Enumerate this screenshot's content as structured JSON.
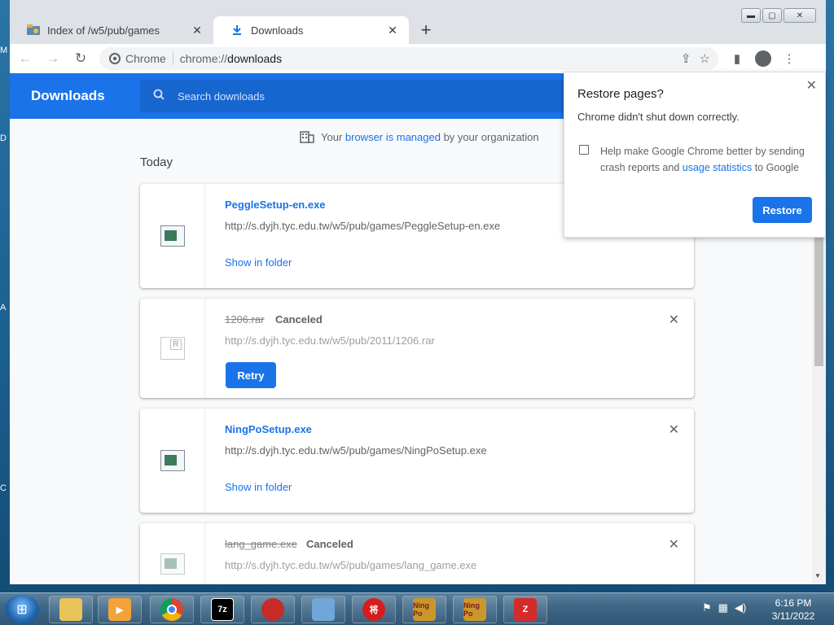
{
  "desktop": {
    "fragments": [
      "M",
      "D",
      "A",
      "C"
    ]
  },
  "window": {
    "tabs": [
      {
        "title": "Index of /w5/pub/games",
        "close": "✕"
      },
      {
        "title": "Downloads",
        "close": "✕"
      }
    ],
    "new_tab": "+",
    "controls": {
      "minimize": "▬",
      "maximize": "▢",
      "close": "✕"
    }
  },
  "toolbar": {
    "back": "←",
    "forward": "→",
    "reload": "↻",
    "chip_label": "Chrome",
    "url_scheme": "chrome://",
    "url_host": "downloads",
    "share": "⇪",
    "bookmark": "☆",
    "sidepanel": "▮",
    "menu": "⋮"
  },
  "downloads": {
    "title": "Downloads",
    "search_placeholder": "Search downloads",
    "managed_pre": "Your ",
    "managed_link": "browser is managed",
    "managed_post": " by your organization",
    "section": "Today",
    "items": [
      {
        "name": "PeggleSetup-en.exe",
        "url": "http://s.dyjh.tyc.edu.tw/w5/pub/games/PeggleSetup-en.exe",
        "action": "Show in folder",
        "status": ""
      },
      {
        "name": "1206.rar",
        "url": "http://s.dyjh.tyc.edu.tw/w5/pub/2011/1206.rar",
        "action": "Retry",
        "status": "Canceled"
      },
      {
        "name": "NingPoSetup.exe",
        "url": "http://s.dyjh.tyc.edu.tw/w5/pub/games/NingPoSetup.exe",
        "action": "Show in folder",
        "status": ""
      },
      {
        "name": "lang_game.exe",
        "url": "http://s.dyjh.tyc.edu.tw/w5/pub/games/lang_game.exe",
        "action": "",
        "status": "Canceled"
      }
    ],
    "remove": "✕",
    "rar_letter": "R"
  },
  "popup": {
    "title": "Restore pages?",
    "description": "Chrome didn't shut down correctly.",
    "checkbox_pre": "Help make Google Chrome better by sending crash reports and ",
    "checkbox_link": "usage statistics",
    "checkbox_post": " to Google",
    "button": "Restore",
    "close": "✕"
  },
  "taskbar": {
    "apps": [
      "explorer",
      "media-player",
      "chrome",
      "7-zip",
      "angry-birds",
      "control-panel",
      "chinese-chess",
      "ningpo-game",
      "ningpo-setup",
      "uninstall-tool"
    ],
    "app_labels": {
      "7zip": "7z",
      "chess": "将",
      "ningpo": "Ning Po",
      "last": "Z"
    },
    "time": "6:16 PM",
    "date": "3/11/2022"
  },
  "colors": {
    "accent": "#1a73e8",
    "header": "#1a73e8",
    "taskbar": "#3f6887"
  }
}
